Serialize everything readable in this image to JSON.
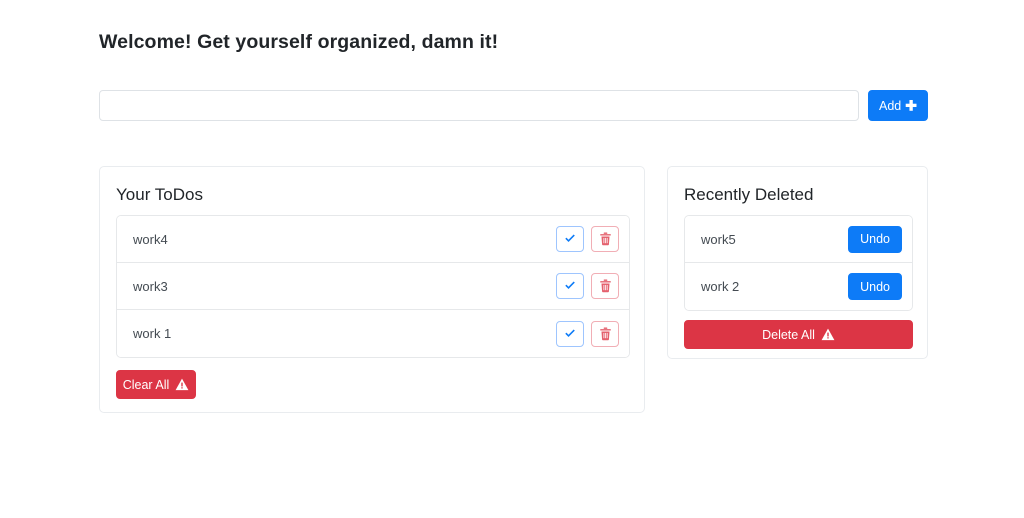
{
  "header": {
    "title": "Welcome! Get yourself organized, damn it!"
  },
  "input_row": {
    "value": "",
    "placeholder": "",
    "add_label": "Add",
    "add_icon": "plus-icon",
    "plus_glyph": "✚"
  },
  "todos_panel": {
    "title": "Your ToDos",
    "items": [
      {
        "label": "work4",
        "complete_icon": "check-icon",
        "delete_icon": "trash-icon"
      },
      {
        "label": "work3",
        "complete_icon": "check-icon",
        "delete_icon": "trash-icon"
      },
      {
        "label": "work 1",
        "complete_icon": "check-icon",
        "delete_icon": "trash-icon"
      }
    ],
    "clear_all_label": "Clear All",
    "clear_all_icon": "warning-triangle-icon"
  },
  "deleted_panel": {
    "title": "Recently Deleted",
    "items": [
      {
        "label": "work5",
        "undo_label": "Undo"
      },
      {
        "label": "work 2",
        "undo_label": "Undo"
      }
    ],
    "delete_all_label": "Delete All",
    "delete_all_icon": "warning-triangle-icon"
  },
  "colors": {
    "primary": "#0d7bf7",
    "danger": "#dc3545",
    "check_border": "#9ec5fe",
    "trash_border": "#f1aeb5",
    "card_border": "#e9ecef",
    "text": "#212529",
    "item_text": "#444b52"
  }
}
